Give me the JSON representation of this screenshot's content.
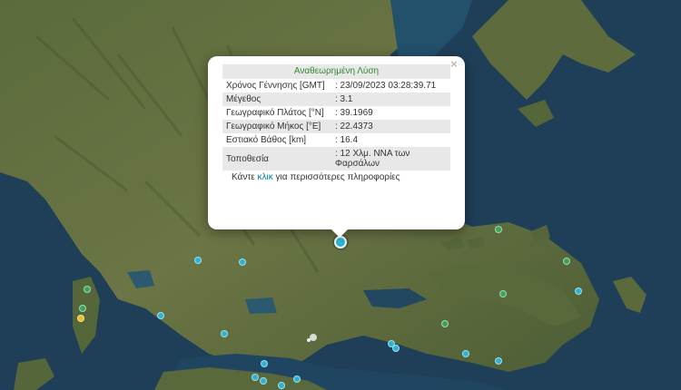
{
  "popup": {
    "title": "Αναθεωρημένη Λύση",
    "close_symbol": "×",
    "rows": [
      {
        "label": "Χρόνος Γέννησης [GMT]",
        "value": ": 23/09/2023 03:28:39.71"
      },
      {
        "label": "Μέγεθος",
        "value": ": 3.1"
      },
      {
        "label": "Γεωγραφικό Πλάτος [°N]",
        "value": ": 39.1969"
      },
      {
        "label": "Γεωγραφικό Μήκος [°E]",
        "value": ": 22.4373"
      },
      {
        "label": "Εστιακό Βάθος [km]",
        "value": ": 16.4"
      },
      {
        "label": "Τοποθεσία",
        "value": ": 12 Χλμ. ΝΝΑ των Φαρσάλων"
      }
    ],
    "more_prefix": "Κάντε",
    "more_link": "κλικ",
    "more_suffix": "για περισσότερες πληροφορίες"
  },
  "map": {
    "marker_colors": {
      "shallow": "#2fb3d2",
      "green": "#3aa55a",
      "yellow": "#e3c32a",
      "selected": "#2fb3d2"
    }
  }
}
